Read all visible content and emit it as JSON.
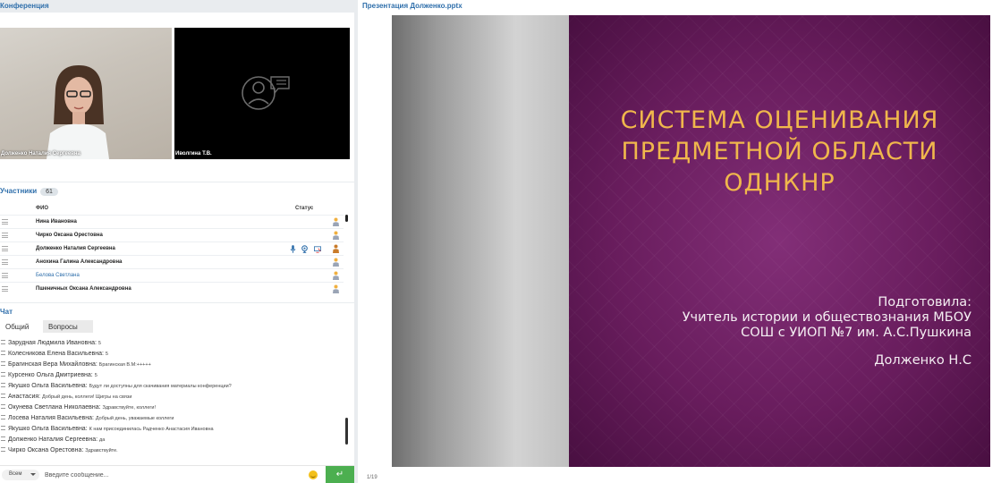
{
  "conference": {
    "title": "Конференция",
    "tiles": [
      {
        "name": "Долженко Наталия Сергеевна"
      },
      {
        "name": "Иволгина Т.В."
      }
    ]
  },
  "participants": {
    "title": "Участники",
    "count": "61",
    "col_fio": "ФИО",
    "col_status": "Статус",
    "rows": [
      {
        "name": "Нина Ивановна"
      },
      {
        "name": "Чирко  Оксана Орестовна"
      },
      {
        "name": "Долженко Наталия Сергеевна"
      },
      {
        "name": "Анохина  Галина Александровна"
      },
      {
        "name": "Белова Светлана"
      },
      {
        "name": "Пшеничных Оксана  Александровна"
      }
    ]
  },
  "chat": {
    "title": "Чат",
    "tab_general": "Общий",
    "tab_questions": "Вопросы",
    "messages": [
      {
        "author": "Зарудная Людмила  Ивановна:",
        "text": "5"
      },
      {
        "author": "Колесникова Елена  Васильевна:",
        "text": "5"
      },
      {
        "author": "Брагинская Вера  Михайловна:",
        "text": "Брагинская В.М:+++++"
      },
      {
        "author": "Курсенко Ольга  Дмитриевна:",
        "text": "5"
      },
      {
        "author": "Якушко Ольга  Васильевна:",
        "text": "Будут ли доступны для скачивания материалы конференции?"
      },
      {
        "author": "Анастасия:",
        "text": "Добрый день, коллеги! Щигры на связи"
      },
      {
        "author": "Окунева Светлана  Николаевна:",
        "text": "Здравствуйте, коллеги!"
      },
      {
        "author": "Лосева Наталия Васильевна:",
        "text": "Добрый день, уважаемые коллеги"
      },
      {
        "author": "Якушко Ольга  Васильевна:",
        "text": "К нам присоединилась Радченко Анастасия Ивановна"
      },
      {
        "author": "Долженко Наталия Сергеевна:",
        "text": "да"
      },
      {
        "author": "Чирко  Оксана Орестовна:",
        "text": "Здравствуйте."
      }
    ],
    "recipient": "Всем",
    "input_placeholder": "Введите сообщение...",
    "send_symbol": "↵"
  },
  "presentation": {
    "title": "Презентация Долженко.pptx",
    "slide_title": "СИСТЕМА ОЦЕНИВАНИЯ ПРЕДМЕТНОЙ ОБЛАСТИ ОДНКНР",
    "prepared_label": "Подготовила:",
    "position_line1": "Учитель истории и обществознания МБОУ",
    "position_line2": "СОШ с УИОП №7 им. А.С.Пушкина",
    "author": "Долженко Н.С",
    "page": "1/19"
  }
}
